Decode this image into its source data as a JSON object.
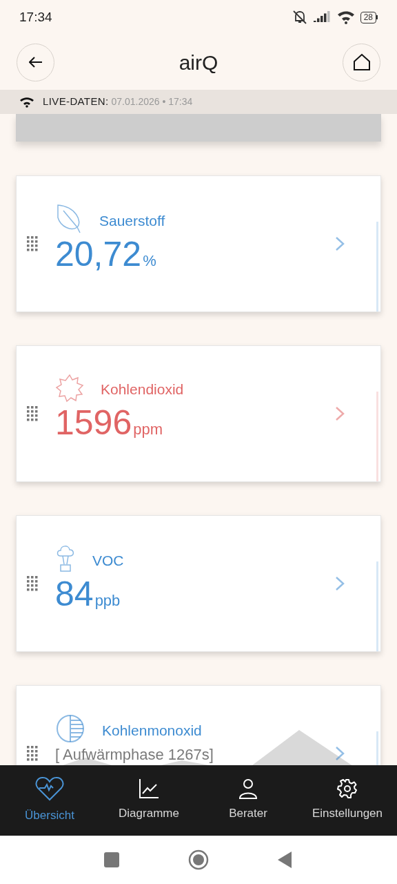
{
  "status_bar": {
    "time": "17:34",
    "battery": "28"
  },
  "header": {
    "title": "airQ"
  },
  "live_bar": {
    "label": "LIVE-DATEN:",
    "timestamp": "07.01.2026 • 17:34"
  },
  "cards": [
    {
      "kind": "value",
      "name": "Sauerstoff",
      "value": "20,72",
      "unit": "%",
      "color": "#3d8bd1"
    },
    {
      "kind": "value",
      "name": "Kohlendioxid",
      "value": "1596",
      "unit": "ppm",
      "color": "#e06464"
    },
    {
      "kind": "value",
      "name": "VOC",
      "value": "84",
      "unit": "ppb",
      "color": "#3d8bd1"
    },
    {
      "kind": "warmup",
      "name": "Kohlenmonoxid",
      "note": "[ Aufwärmphase 1267s]",
      "color": "#3d8bd1"
    }
  ],
  "bottom_nav": [
    {
      "label": "Übersicht",
      "selected": true
    },
    {
      "label": "Diagramme",
      "selected": false
    },
    {
      "label": "Berater",
      "selected": false
    },
    {
      "label": "Einstellungen",
      "selected": false
    }
  ]
}
